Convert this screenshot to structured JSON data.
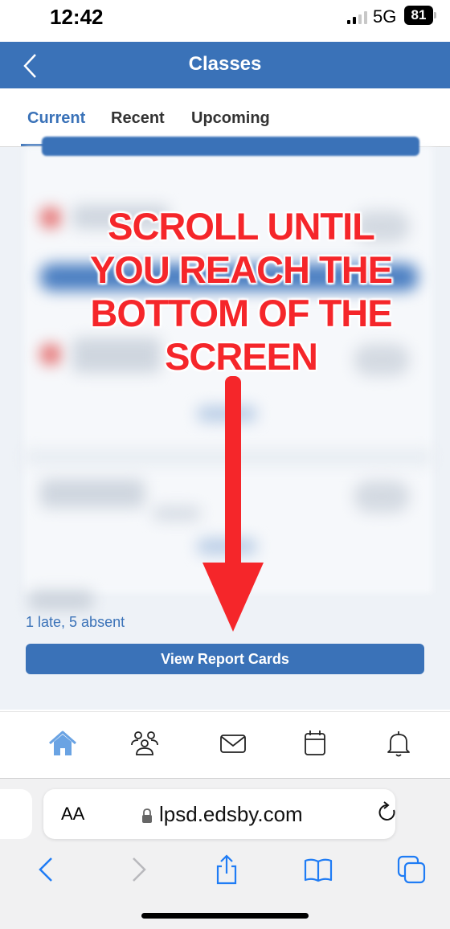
{
  "status_bar": {
    "time": "12:42",
    "network": "5G",
    "battery": "81"
  },
  "header": {
    "title": "Classes"
  },
  "tabs": [
    {
      "label": "Current"
    },
    {
      "label": "Recent"
    },
    {
      "label": "Upcoming"
    }
  ],
  "content": {
    "overlay_text": "SCROLL UNTIL YOU REACH THE BOTTOM OF THE SCREEN",
    "attendance": "1 late, 5 absent",
    "report_button": "View Report Cards"
  },
  "bottom_nav": [
    "home-icon",
    "people-icon",
    "mail-icon",
    "calendar-icon",
    "bell-icon"
  ],
  "browser": {
    "aa_label": "AA",
    "url": "lpsd.edsby.com"
  },
  "colors": {
    "brand": "#3a72b8",
    "annotation": "#f5262a"
  }
}
